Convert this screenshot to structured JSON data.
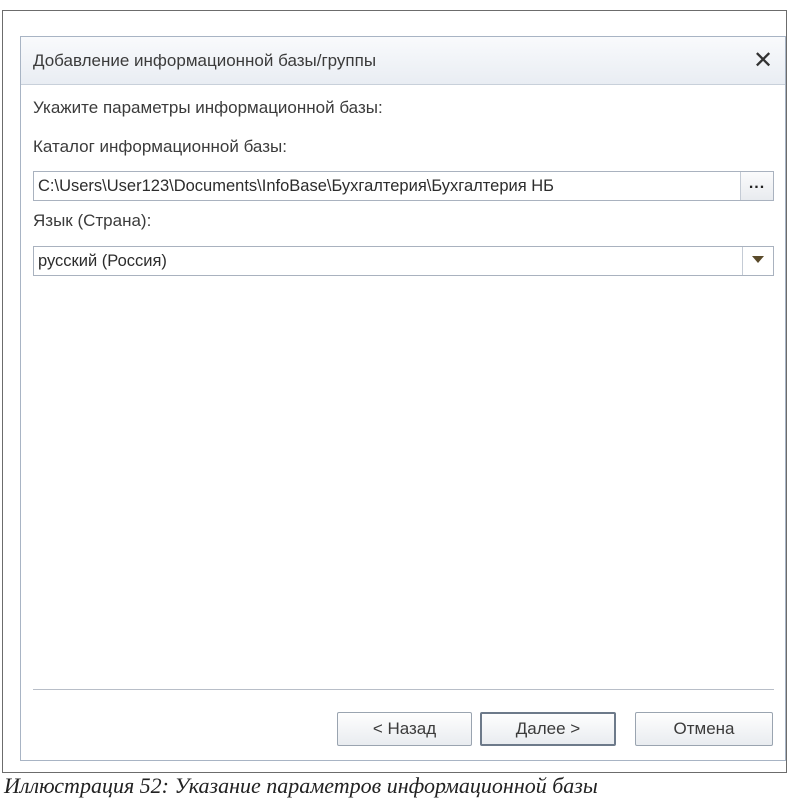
{
  "dialog": {
    "title": "Добавление информационной базы/группы",
    "heading": "Укажите параметры информационной базы:",
    "catalog_label": "Каталог информационной базы:",
    "catalog_value": "C:\\Users\\User123\\Documents\\InfoBase\\Бухгалтерия\\Бухгалтерия НБ",
    "browse_label": "...",
    "language_label": "Язык (Страна):",
    "language_value": "русский (Россия)",
    "buttons": {
      "back": "< Назад",
      "next": "Далее >",
      "cancel": "Отмена"
    },
    "close_glyph": "✕"
  },
  "caption": "Иллюстрация 52: Указание параметров информационной базы",
  "colors": {
    "border": "#a8b4c4",
    "title_bar": "#eef1f5",
    "text": "#3b3b3b",
    "dropdown_arrow": "#5a4a2a"
  },
  "icons": [
    "close-icon",
    "ellipsis-icon",
    "dropdown-arrow-icon"
  ]
}
